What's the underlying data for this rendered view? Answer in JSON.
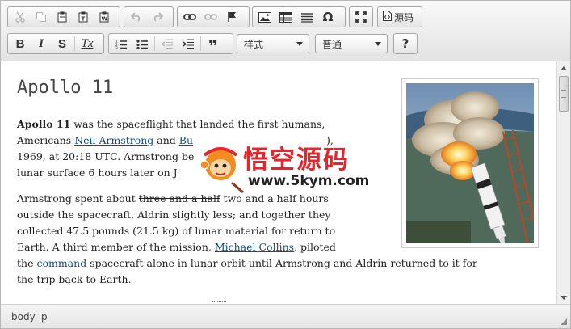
{
  "toolbar": {
    "row1": [
      "cut-icon",
      "copy-icon",
      "paste-icon",
      "paste-text-icon",
      "paste-word-icon",
      "undo-icon",
      "redo-icon",
      "link-icon",
      "unlink-icon",
      "anchor-icon",
      "image-icon",
      "table-icon",
      "horizontal-rule-icon",
      "special-char-icon",
      "maximize-icon",
      "source-icon"
    ],
    "source_label": "源码",
    "format_styles": "样式",
    "format_block": "普通",
    "help_label": "?",
    "bold_label": "B",
    "italic_label": "I",
    "strike_label": "S",
    "remove_format_label": "Tx",
    "omega_label": "Ω",
    "quote_label": "❞"
  },
  "content": {
    "heading": "Apollo 11",
    "p1": {
      "lead_bold": "Apollo 11",
      "t1": " was the spaceflight that landed the first humans,",
      "t2": "Americans ",
      "link1": "Neil Armstrong",
      "t3": " and ",
      "link2": "Bu",
      "t4": "),",
      "line3": "1969, at 20:18 UTC. Armstrong be",
      "line4": "lunar surface 6 hours later on J"
    },
    "p2": {
      "t1": "Armstrong spent about ",
      "strike": "three and a half",
      "t2": " two and a half hours",
      "line2": "outside the spacecraft, Aldrin slightly less; and together they",
      "line3": "collected 47.5 pounds (21.5 kg) of lunar material for return to",
      "line4a": "Earth. A third member of the mission, ",
      "link_collins": "Michael Collins",
      "line4b": ", piloted",
      "line5a": "the ",
      "link_command": "command",
      "line5b": " spacecraft alone in lunar orbit until Armstrong and Aldrin returned to it for",
      "line6": "the trip back to Earth."
    }
  },
  "watermark": {
    "title": "悟空源码",
    "url": "www.5kym.com"
  },
  "statusbar": {
    "path": [
      "body",
      "p"
    ]
  },
  "colors": {
    "link": "#0f4d8a",
    "watermark_red": "#e6262b"
  }
}
